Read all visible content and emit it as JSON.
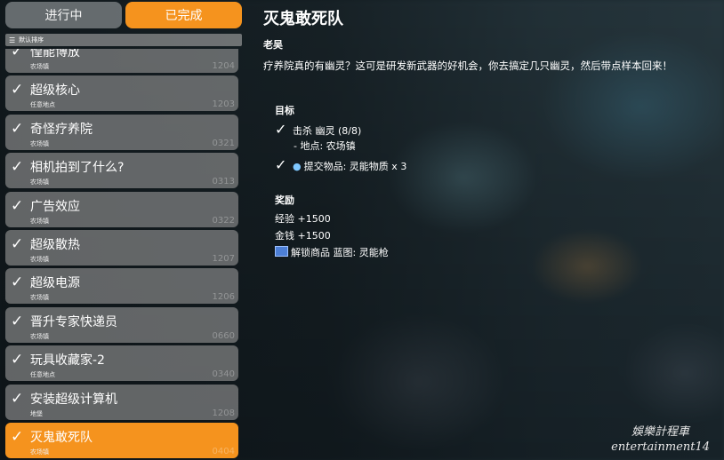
{
  "tabs": {
    "in_progress": "进行中",
    "completed": "已完成"
  },
  "sort": {
    "label": "默认排序"
  },
  "quests": [
    {
      "title": "惶能博放",
      "location": "农场镇",
      "number": "1204",
      "selected": false
    },
    {
      "title": "超级核心",
      "location": "任意地点",
      "number": "1203",
      "selected": false
    },
    {
      "title": "奇怪疗养院",
      "location": "农场镇",
      "number": "0321",
      "selected": false
    },
    {
      "title": "相机拍到了什么?",
      "location": "农场镇",
      "number": "0313",
      "selected": false
    },
    {
      "title": "广告效应",
      "location": "农场镇",
      "number": "0322",
      "selected": false
    },
    {
      "title": "超级散热",
      "location": "农场镇",
      "number": "1207",
      "selected": false
    },
    {
      "title": "超级电源",
      "location": "农场镇",
      "number": "1206",
      "selected": false
    },
    {
      "title": "晋升专家快递员",
      "location": "农场镇",
      "number": "0660",
      "selected": false
    },
    {
      "title": "玩具收藏家-2",
      "location": "任意地点",
      "number": "0340",
      "selected": false
    },
    {
      "title": "安装超级计算机",
      "location": "地堡",
      "number": "1208",
      "selected": false
    },
    {
      "title": "灭鬼敢死队",
      "location": "农场镇",
      "number": "0404",
      "selected": true
    }
  ],
  "detail": {
    "title": "灭鬼敢死队",
    "giver": "老吴",
    "description": "疗养院真的有幽灵？这可是研发新武器的好机会，你去搞定几只幽灵，然后带点样本回来！",
    "objectives_header": "目标",
    "objectives": [
      {
        "text": "击杀 幽灵 (8/8)",
        "sub": "- 地点: 农场镇",
        "icon": "check-icon"
      },
      {
        "text": "提交物品: 灵能物质 x 3",
        "sub": "",
        "icon": "check-icon",
        "item_icon": "ghost-matter-icon"
      }
    ],
    "rewards_header": "奖励",
    "rewards": [
      {
        "text": "经验 +1500"
      },
      {
        "text": "金钱 +1500"
      },
      {
        "text": "解锁商品 蓝图: 灵能枪",
        "icon": "blueprint-icon"
      }
    ]
  },
  "watermark": {
    "line1": "娛樂計程車",
    "line2": "entertainment14"
  },
  "colors": {
    "accent": "#f5931e",
    "card": "#969696"
  }
}
